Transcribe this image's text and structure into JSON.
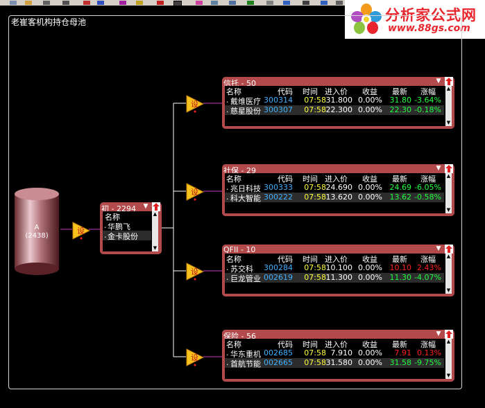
{
  "frame": {
    "title": "老崔客机构持仓母池"
  },
  "logo": {
    "title": "分析家公式网",
    "url": "www.88gs.com"
  },
  "source": {
    "label": "A",
    "count": "(2438)"
  },
  "trigger": {
    "glyph": "设"
  },
  "main_pool": {
    "title": "初 - 2294",
    "header": "名称",
    "items": [
      "华鹏飞",
      "金卡股份"
    ]
  },
  "columns": [
    "名称",
    "代码",
    "时间",
    "进入价",
    "收益",
    "最新",
    "涨幅"
  ],
  "pools": [
    {
      "title": "信托 - 50",
      "rows": [
        {
          "name": "戴维医疗",
          "code": "300314",
          "time": "07:58",
          "entry": "31.800",
          "profit": "0.00%",
          "latest": "31.80",
          "change": "-3.64%",
          "dir": "down"
        },
        {
          "name": "慈星股份",
          "code": "300307",
          "time": "07:58",
          "entry": "22.300",
          "profit": "0.00%",
          "latest": "22.30",
          "change": "-0.18%",
          "dir": "down"
        }
      ]
    },
    {
      "title": "社保 - 29",
      "rows": [
        {
          "name": "兆日科技",
          "code": "300333",
          "time": "07:58",
          "entry": "24.690",
          "profit": "0.00%",
          "latest": "24.69",
          "change": "-6.05%",
          "dir": "down"
        },
        {
          "name": "科大智能",
          "code": "300222",
          "time": "07:58",
          "entry": "13.620",
          "profit": "0.00%",
          "latest": "13.62",
          "change": "-0.58%",
          "dir": "down"
        }
      ]
    },
    {
      "title": "QFII - 10",
      "rows": [
        {
          "name": "苏交科",
          "code": "300284",
          "time": "07:58",
          "entry": "10.100",
          "profit": "0.00%",
          "latest": "10.10",
          "change": "2.43%",
          "dir": "up"
        },
        {
          "name": "巨龙管业",
          "code": "002619",
          "time": "07:58",
          "entry": "11.300",
          "profit": "0.00%",
          "latest": "11.30",
          "change": "-4.07%",
          "dir": "down"
        }
      ]
    },
    {
      "title": "保险 - 56",
      "rows": [
        {
          "name": "华东重机",
          "code": "002685",
          "time": "07:58",
          "entry": "7.910",
          "profit": "0.00%",
          "latest": "7.91",
          "change": "0.13%",
          "dir": "up"
        },
        {
          "name": "首航节能",
          "code": "002665",
          "time": "07:58",
          "entry": "31.580",
          "profit": "0.00%",
          "latest": "31.58",
          "change": "-9.75%",
          "dir": "down"
        }
      ]
    }
  ],
  "colors": {
    "panel": "#b24a4c",
    "up": "#ff2020",
    "down": "#20ff40",
    "code": "#3fb0ff",
    "time": "#ffff40",
    "wire": "#c040c0"
  }
}
